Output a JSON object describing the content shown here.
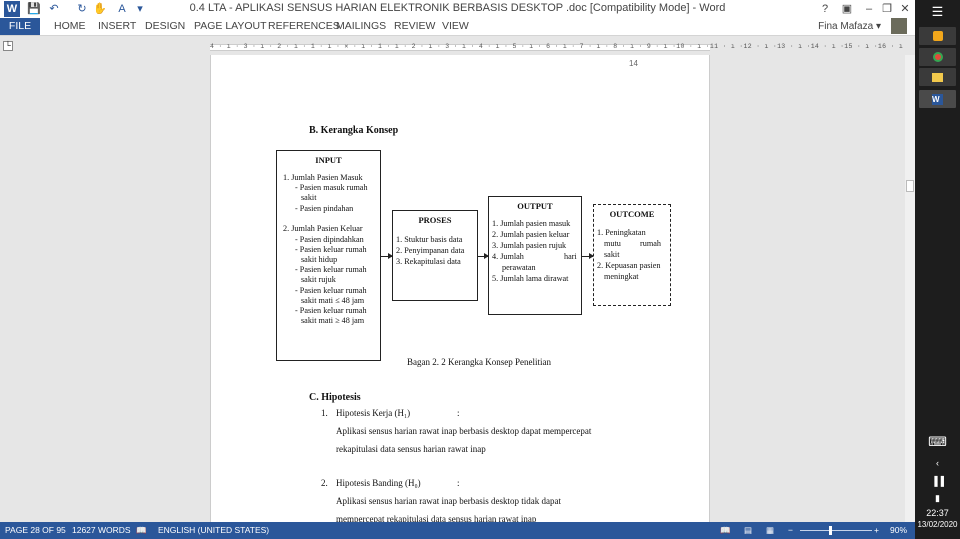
{
  "window": {
    "title": "0.4 LTA - APLIKASI SENSUS HARIAN ELEKTRONIK BERBASIS DESKTOP .doc [Compatibility Mode] - Word",
    "help": "?"
  },
  "ribbon": {
    "tabs": [
      "FILE",
      "HOME",
      "INSERT",
      "DESIGN",
      "PAGE LAYOUT",
      "REFERENCES",
      "MAILINGS",
      "REVIEW",
      "VIEW"
    ],
    "user": "Fina Mafaza"
  },
  "ruler": {
    "ticks": "4 · ı · 3 · ı · 2 · ı · 1 · ı · ✕ · ı · 1 · ı · 2 · ı · 3 · ı · 4 · ı · 5 · ı · 6 · ı · 7 · ı · 8 · ı · 9 · ı ·10 · ı ·11 · ı ·12 · ı ·13 · ı ·14 · ı ·15 · ı ·16 · ı"
  },
  "document": {
    "page_number": "14",
    "section_b": "B.  Kerangka Konsep",
    "input": {
      "title": "INPUT",
      "lines": [
        "1. Jumlah Pasien Masuk",
        "- Pasien  masuk  rumah",
        "sakit",
        "- Pasien pindahan",
        "2. Jumlah Pasien Keluar",
        "- Pasien dipindahkan",
        "- Pasien  keluar  rumah",
        "sakit hidup",
        "- Pasien  keluar  rumah",
        "sakit rujuk",
        "- Pasien  keluar  rumah",
        "sakit mati ≤ 48 jam",
        "- Pasien  keluar  rumah",
        "sakit mati  ≥ 48 jam"
      ]
    },
    "proses": {
      "title": "PROSES",
      "lines": [
        "1. Stuktur basis data",
        "2. Penyimpanan data",
        "3. Rekapitulasi data"
      ]
    },
    "output": {
      "title": "OUTPUT",
      "lines": [
        "1. Jumlah pasien masuk",
        "2. Jumlah pasien keluar",
        "3. Jumlah pasien rujuk",
        "4. Jumlah",
        "hari",
        "perawatan",
        "5. Jumlah lama dirawat"
      ]
    },
    "outcome": {
      "title": "OUTCOME",
      "lines": [
        "1. Peningkatan",
        "mutu",
        "rumah",
        "sakit",
        "2. Kepuasan  pasien",
        "meningkat"
      ]
    },
    "caption": "Bagan 2.  2 Kerangka Konsep Penelitian",
    "section_c": "C.  Hipotesis",
    "h1": {
      "number": "1.",
      "label": "Hipotesis Kerja (H₁)",
      "colon": ":",
      "line1": "Aplikasi  sensus  harian  rawat  inap  berbasis  desktop  dapat  mempercepat",
      "line2": "rekapitulasi data sensus harian rawat inap"
    },
    "h0": {
      "number": "2.",
      "label": "Hipotesis Banding (H₀)",
      "colon": ":",
      "line1": "Aplikasi    sensus    harian    rawat    inap    berbasis    desktop    tidak    dapat",
      "line2": "mempercepat rekapitulasi data sensus harian rawat inap"
    }
  },
  "statusbar": {
    "page": "PAGE 28 OF 95",
    "words": "12627 WORDS",
    "language": "ENGLISH (UNITED STATES)",
    "zoom_minus": "−",
    "zoom_plus": "+",
    "zoom": "90%",
    "zoom_level": 0.9
  },
  "taskbar": {
    "time": "22:37",
    "date": "13/02/2020"
  },
  "colors": {
    "word_blue": "#2b579a",
    "taskbar": "#1d1d1d"
  }
}
